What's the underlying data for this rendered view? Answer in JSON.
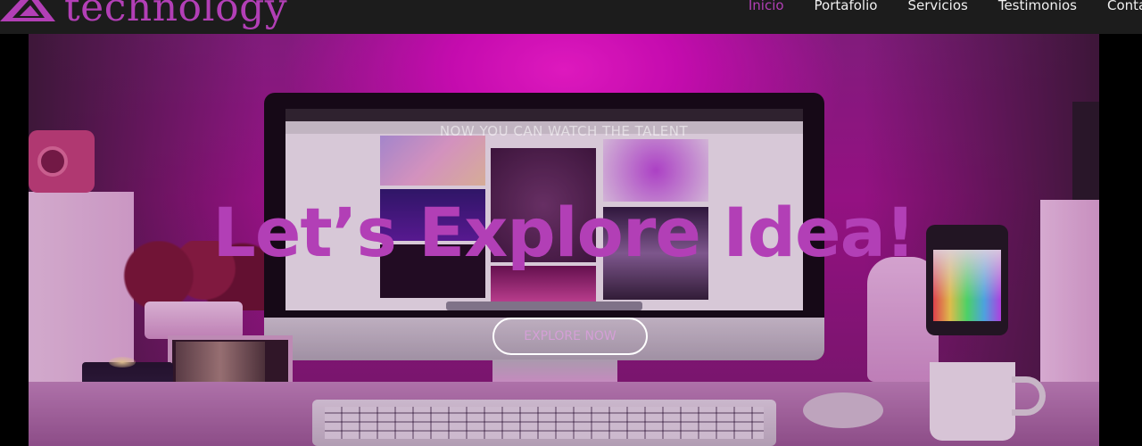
{
  "brand": {
    "name": "technology",
    "logo_icon": "logo-mark-icon",
    "brand_color": "#b23fb6"
  },
  "nav": {
    "items": [
      {
        "label": "Inicio",
        "active": true
      },
      {
        "label": "Portafolio",
        "active": false
      },
      {
        "label": "Servicios",
        "active": false
      },
      {
        "label": "Testimonios",
        "active": false
      },
      {
        "label": "Contact",
        "active": false
      }
    ]
  },
  "hero": {
    "subtitle": "NOW YOU CAN WATCH THE TALENT",
    "headline": "Let’s Explore Idea!",
    "cta_label": "EXPLORE NOW",
    "image_subject": "desk-setup-monitor-icon"
  },
  "colors": {
    "header_bg": "#1c1c1c",
    "accent": "#b23fb6",
    "nav_text": "#f0f0f0"
  }
}
